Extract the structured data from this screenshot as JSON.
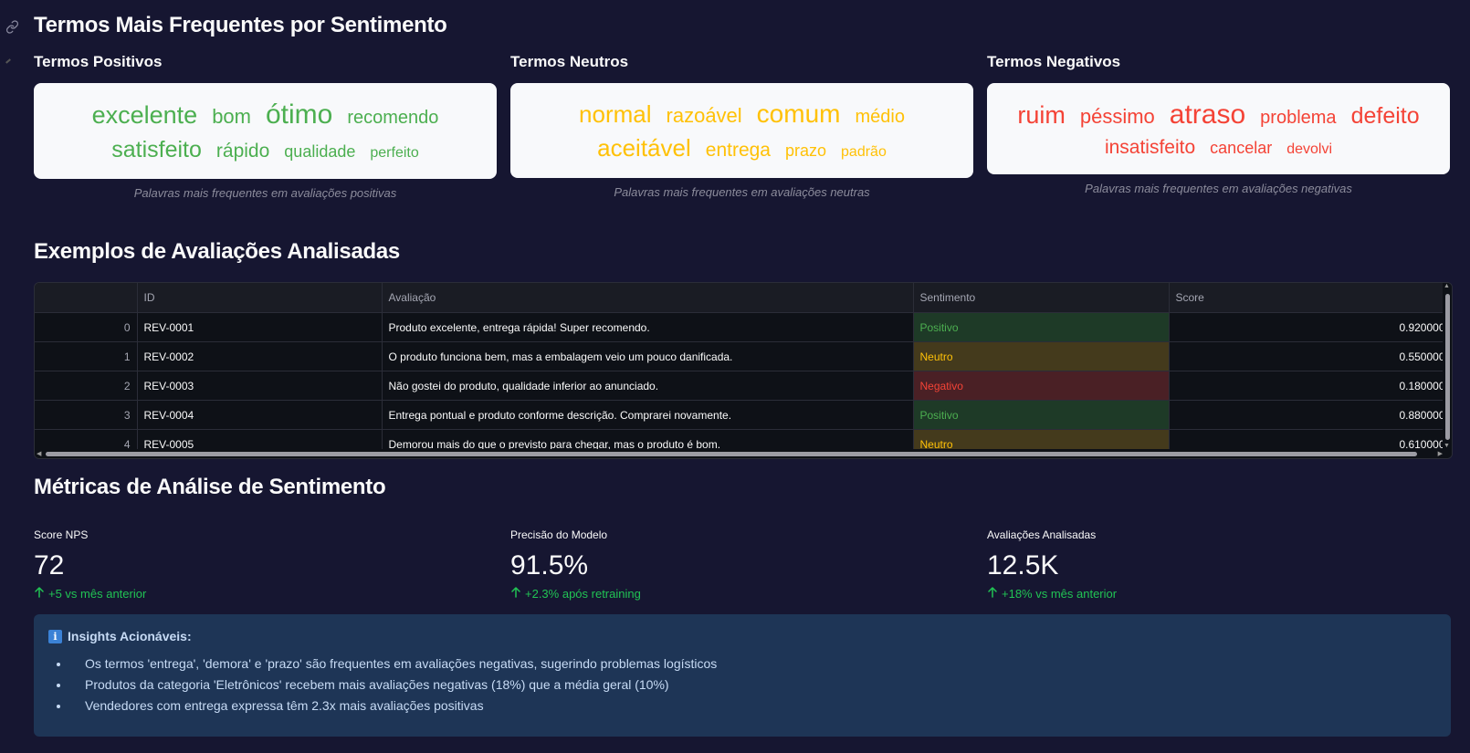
{
  "sections": {
    "word_clouds_title": "Termos Mais Frequentes por Sentimento",
    "examples_title": "Exemplos de Avaliações Analisadas",
    "metrics_title": "Métricas de Análise de Sentimento"
  },
  "clouds": [
    {
      "title": "Termos Positivos",
      "color": "#4caf50",
      "words": [
        {
          "text": "excelente",
          "size": 27
        },
        {
          "text": "bom",
          "size": 22
        },
        {
          "text": "ótimo",
          "size": 30
        },
        {
          "text": "recomendo",
          "size": 20
        },
        {
          "text": "satisfeito",
          "size": 25
        },
        {
          "text": "rápido",
          "size": 21
        },
        {
          "text": "qualidade",
          "size": 18
        },
        {
          "text": "perfeito",
          "size": 16
        }
      ],
      "caption": "Palavras mais frequentes em avaliações positivas"
    },
    {
      "title": "Termos Neutros",
      "color": "#ffc107",
      "words": [
        {
          "text": "normal",
          "size": 26
        },
        {
          "text": "razoável",
          "size": 22
        },
        {
          "text": "comum",
          "size": 28
        },
        {
          "text": "médio",
          "size": 20
        },
        {
          "text": "aceitável",
          "size": 26
        },
        {
          "text": "entrega",
          "size": 21
        },
        {
          "text": "prazo",
          "size": 18
        },
        {
          "text": "padrão",
          "size": 16
        }
      ],
      "caption": "Palavras mais frequentes em avaliações neutras"
    },
    {
      "title": "Termos Negativos",
      "color": "#f44336",
      "words": [
        {
          "text": "ruim",
          "size": 27
        },
        {
          "text": "péssimo",
          "size": 22
        },
        {
          "text": "atraso",
          "size": 30
        },
        {
          "text": "problema",
          "size": 20
        },
        {
          "text": "defeito",
          "size": 25
        },
        {
          "text": "insatisfeito",
          "size": 21
        },
        {
          "text": "cancelar",
          "size": 18
        },
        {
          "text": "devolvi",
          "size": 16
        }
      ],
      "caption": "Palavras mais frequentes em avaliações negativas"
    }
  ],
  "table": {
    "columns": [
      "",
      "ID",
      "Avaliação",
      "Sentimento",
      "Score"
    ],
    "rows": [
      {
        "index": "0",
        "id": "REV-0001",
        "review": "Produto excelente, entrega rápida! Super recomendo.",
        "sentiment": "Positivo",
        "score": "0.920000"
      },
      {
        "index": "1",
        "id": "REV-0002",
        "review": "O produto funciona bem, mas a embalagem veio um pouco danificada.",
        "sentiment": "Neutro",
        "score": "0.550000"
      },
      {
        "index": "2",
        "id": "REV-0003",
        "review": "Não gostei do produto, qualidade inferior ao anunciado.",
        "sentiment": "Negativo",
        "score": "0.180000"
      },
      {
        "index": "3",
        "id": "REV-0004",
        "review": "Entrega pontual e produto conforme descrição. Comprarei novamente.",
        "sentiment": "Positivo",
        "score": "0.880000"
      },
      {
        "index": "4",
        "id": "REV-0005",
        "review": "Demorou mais do que o previsto para chegar, mas o produto é bom.",
        "sentiment": "Neutro",
        "score": "0.610000"
      }
    ]
  },
  "metrics": [
    {
      "label": "Score NPS",
      "value": "72",
      "delta": "+5 vs mês anterior"
    },
    {
      "label": "Precisão do Modelo",
      "value": "91.5%",
      "delta": "+2.3% após retraining"
    },
    {
      "label": "Avaliações Analisadas",
      "value": "12.5K",
      "delta": "+18% vs mês anterior"
    }
  ],
  "insights": {
    "title": "Insights Acionáveis:",
    "items": [
      "Os termos 'entrega', 'demora' e 'prazo' são frequentes em avaliações negativas, sugerindo problemas logísticos",
      "Produtos da categoria 'Eletrônicos' recebem mais avaliações negativas (18%) que a média geral (10%)",
      "Vendedores com entrega expressa têm 2.3x mais avaliações positivas"
    ]
  },
  "icons": {
    "link": "link-icon",
    "info": "info-icon",
    "delta_up": "arrow-up-icon"
  }
}
